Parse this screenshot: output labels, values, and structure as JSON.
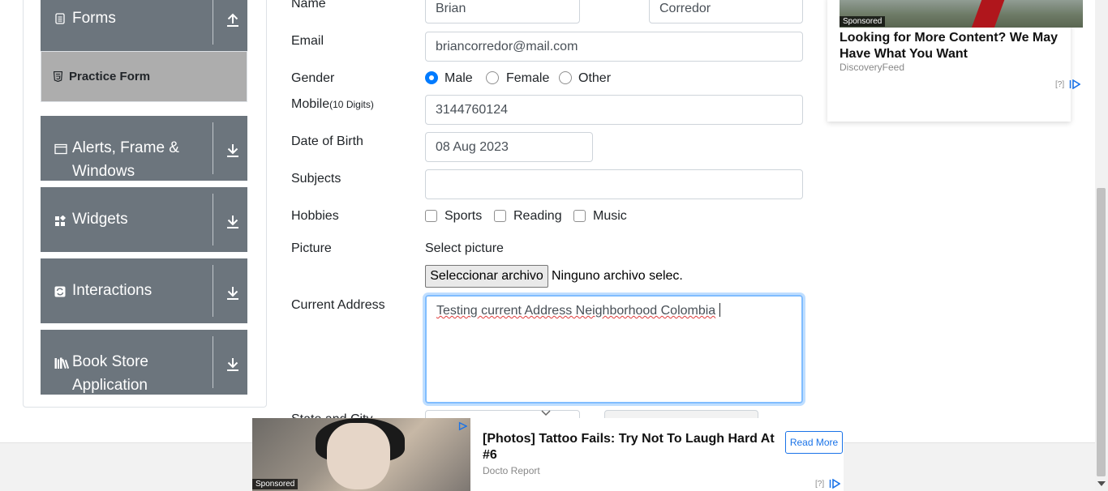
{
  "sidebar": {
    "groups": [
      {
        "label": "Forms",
        "icon": "document-icon",
        "arrow": "up-arrow-icon"
      },
      {
        "label": "Alerts, Frame & Windows",
        "icon": "window-icon",
        "arrow": "down-arrow-icon"
      },
      {
        "label": "Widgets",
        "icon": "widgets-icon",
        "arrow": "down-arrow-icon"
      },
      {
        "label": "Interactions",
        "icon": "interactions-icon",
        "arrow": "down-arrow-icon"
      },
      {
        "label": "Book Store Application",
        "icon": "books-icon",
        "arrow": "down-arrow-icon"
      }
    ],
    "active_item": "Practice Form"
  },
  "form": {
    "name_label": "Name",
    "first_name": "Brian",
    "last_name": "Corredor",
    "email_label": "Email",
    "email": "briancorredor@mail.com",
    "gender_label": "Gender",
    "gender_options": [
      "Male",
      "Female",
      "Other"
    ],
    "gender_selected": "Male",
    "mobile_label": "Mobile",
    "mobile_hint": "(10 Digits)",
    "mobile": "3144760124",
    "dob_label": "Date of Birth",
    "dob": "08 Aug 2023",
    "subjects_label": "Subjects",
    "hobbies_label": "Hobbies",
    "hobbies": [
      "Sports",
      "Reading",
      "Music"
    ],
    "picture_label": "Picture",
    "picture_prompt": "Select picture",
    "file_button": "Seleccionar archivo",
    "file_status": "Ninguno archivo selec.",
    "address_label": "Current Address",
    "address_value": "Testing current Address Neighborhood Colombia",
    "state_city_label": "State and City"
  },
  "ads": {
    "top_right": {
      "badge": "Sponsored",
      "headline": "Looking for More Content? We May Have What You Want",
      "source": "DiscoveryFeed",
      "choices": "[?]"
    },
    "bottom": {
      "badge": "Sponsored",
      "headline": "[Photos] Tattoo Fails: Try Not To Laugh Hard At #6",
      "source": "Docto Report",
      "cta": "Read More",
      "choices": "[?]"
    }
  },
  "colors": {
    "sidebar_group": "#6c757d",
    "active_item": "#adadad",
    "accent": "#007bff",
    "focus_border": "#80bdff"
  }
}
